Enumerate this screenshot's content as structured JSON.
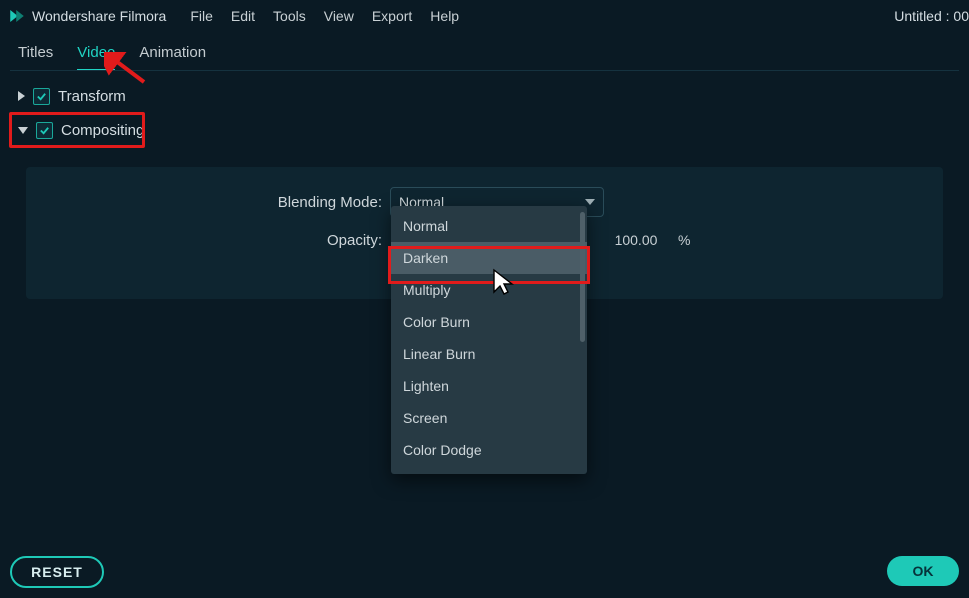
{
  "app": {
    "title": "Wondershare Filmora",
    "project_name": "Untitled : 00"
  },
  "menu": {
    "items": [
      "File",
      "Edit",
      "Tools",
      "View",
      "Export",
      "Help"
    ]
  },
  "tabs": {
    "items": [
      "Titles",
      "Video",
      "Animation"
    ],
    "active_index": 1
  },
  "sections": {
    "transform": {
      "label": "Transform",
      "checked": true,
      "expanded": false
    },
    "compositing": {
      "label": "Compositing",
      "checked": true,
      "expanded": true
    }
  },
  "panel": {
    "blending_mode_label": "Blending Mode:",
    "blending_mode_selected": "Normal",
    "opacity_label": "Opacity:",
    "opacity_value": "100.00",
    "opacity_unit": "%"
  },
  "dropdown": {
    "options": [
      "Normal",
      "Darken",
      "Multiply",
      "Color Burn",
      "Linear Burn",
      "Lighten",
      "Screen",
      "Color Dodge"
    ],
    "hover_index": 1
  },
  "buttons": {
    "reset": "RESET",
    "ok": "OK"
  },
  "colors": {
    "accent": "#1ec9b7",
    "highlight_red": "#e11b1b"
  }
}
